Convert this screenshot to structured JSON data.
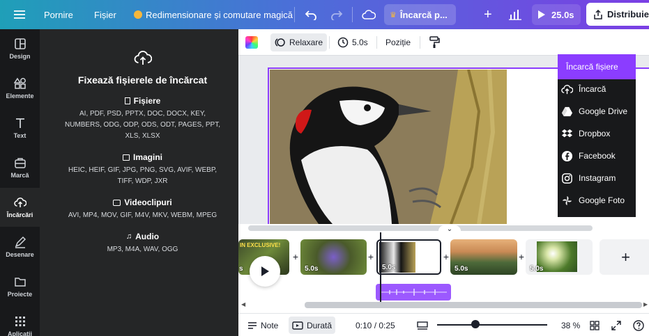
{
  "topbar": {
    "home": "Pornire",
    "file": "Fișier",
    "magic": "Redimensionare și comutare magică",
    "upload_title": "Încarcă p...",
    "duration": "25.0s",
    "share": "Distribuie"
  },
  "rail": {
    "items": [
      {
        "label": "Design",
        "icon": "design-icon"
      },
      {
        "label": "Elemente",
        "icon": "elements-icon"
      },
      {
        "label": "Text",
        "icon": "text-icon"
      },
      {
        "label": "Marcă",
        "icon": "brand-icon"
      },
      {
        "label": "Încărcări",
        "icon": "upload-icon"
      },
      {
        "label": "Desenare",
        "icon": "draw-icon"
      },
      {
        "label": "Proiecte",
        "icon": "folder-icon"
      },
      {
        "label": "Aplicații",
        "icon": "apps-icon"
      }
    ]
  },
  "panel": {
    "title": "Fixează fișierele de încărcat",
    "sections": [
      {
        "title": "Fișiere",
        "body": "AI, PDF, PSD, PPTX, DOC, DOCX, KEY, NUMBERS, ODG, ODP, ODS, ODT, PAGES, PPT, XLS, XLSX"
      },
      {
        "title": "Imagini",
        "body": "HEIC, HEIF, GIF, JPG, PNG, SVG, AVIF, WEBP, TIFF, WDP, JXR"
      },
      {
        "title": "Videoclipuri",
        "body": "AVI, MP4, MOV, GIF, M4V, MKV, WEBM, MPEG"
      },
      {
        "title": "Audio",
        "body": "MP3, M4A, WAV, OGG"
      }
    ]
  },
  "editor_toolbar": {
    "animate": "Relaxare",
    "duration": "5.0s",
    "position": "Poziție"
  },
  "dropdown": {
    "header": "Încarcă fișiere",
    "items": [
      {
        "label": "Încarcă",
        "icon": "cloud-upload-icon"
      },
      {
        "label": "Google Drive",
        "icon": "google-drive-icon"
      },
      {
        "label": "Dropbox",
        "icon": "dropbox-icon"
      },
      {
        "label": "Facebook",
        "icon": "facebook-icon"
      },
      {
        "label": "Instagram",
        "icon": "instagram-icon"
      },
      {
        "label": "Google Foto",
        "icon": "google-photos-icon"
      }
    ]
  },
  "timeline": {
    "clips": [
      {
        "label": "s",
        "overlay_text": "IN EXCLUSIVE!"
      },
      {
        "label": "5.0s"
      },
      {
        "label": "5.0s"
      },
      {
        "label": "5.0s"
      },
      {
        "label": "5.0s"
      }
    ]
  },
  "bottombar": {
    "notes": "Note",
    "duration": "Durată",
    "time": "0:10 / 0:25",
    "zoom": "38 %"
  },
  "colors": {
    "accent": "#8b3dff",
    "dark": "#18191b",
    "panel": "#252627"
  }
}
